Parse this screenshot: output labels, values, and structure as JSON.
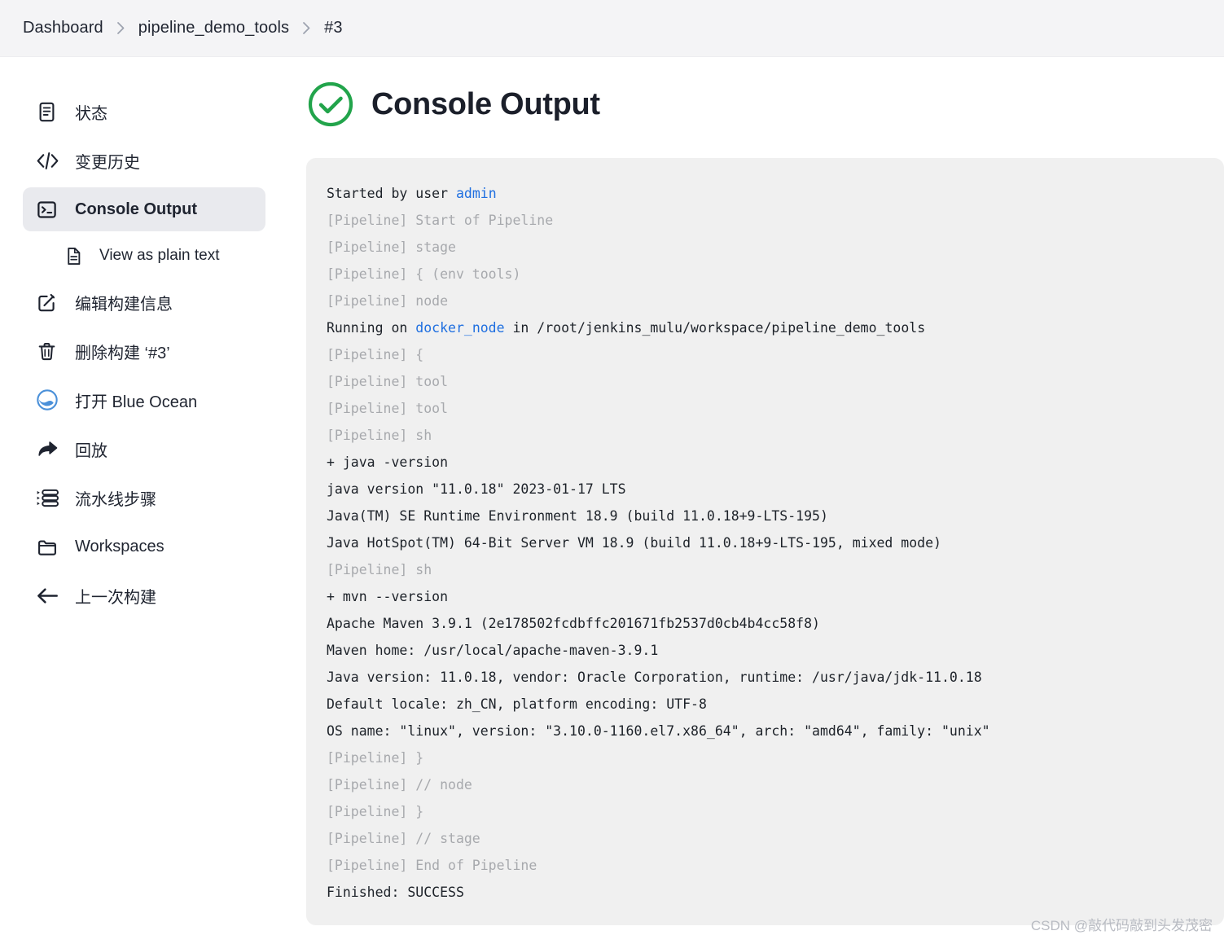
{
  "breadcrumb": {
    "items": [
      {
        "label": "Dashboard",
        "name": "breadcrumb-dashboard"
      },
      {
        "label": "pipeline_demo_tools",
        "name": "breadcrumb-job"
      },
      {
        "label": "#3",
        "name": "breadcrumb-build"
      }
    ],
    "separator": "›"
  },
  "sidebar": {
    "items": [
      {
        "label": "状态",
        "icon": "document-icon",
        "name": "sidebar-item-status",
        "active": false,
        "sub": false
      },
      {
        "label": "变更历史",
        "icon": "code-icon",
        "name": "sidebar-item-changes",
        "active": false,
        "sub": false
      },
      {
        "label": "Console Output",
        "icon": "terminal-icon",
        "name": "sidebar-item-console-output",
        "active": true,
        "sub": false
      },
      {
        "label": "View as plain text",
        "icon": "plain-text-icon",
        "name": "sidebar-item-view-as-plain-text",
        "active": false,
        "sub": true
      },
      {
        "label": "编辑构建信息",
        "icon": "edit-icon",
        "name": "sidebar-item-edit-build-information",
        "active": false,
        "sub": false
      },
      {
        "label": "删除构建 ‘#3’",
        "icon": "trash-icon",
        "name": "sidebar-item-delete-build",
        "active": false,
        "sub": false
      },
      {
        "label": "打开 Blue Ocean",
        "icon": "blue-ocean-icon",
        "name": "sidebar-item-open-blue-ocean",
        "active": false,
        "sub": false
      },
      {
        "label": "回放",
        "icon": "replay-icon",
        "name": "sidebar-item-replay",
        "active": false,
        "sub": false
      },
      {
        "label": "流水线步骤",
        "icon": "pipeline-steps-icon",
        "name": "sidebar-item-pipeline-steps",
        "active": false,
        "sub": false
      },
      {
        "label": "Workspaces",
        "icon": "folder-icon",
        "name": "sidebar-item-workspaces",
        "active": false,
        "sub": false
      },
      {
        "label": "上一次构建",
        "icon": "arrow-left-icon",
        "name": "sidebar-item-previous-build",
        "active": false,
        "sub": false
      }
    ]
  },
  "main": {
    "title": "Console Output",
    "status_icon": "success-check-icon",
    "status_color": "#22a44b",
    "link_color": "#1f6fe0",
    "console_lines": [
      {
        "style": "normal",
        "segments": [
          {
            "t": "Started by user "
          },
          {
            "t": "admin",
            "link": true
          }
        ]
      },
      {
        "style": "dim",
        "segments": [
          {
            "t": "[Pipeline] Start of Pipeline"
          }
        ]
      },
      {
        "style": "dim",
        "segments": [
          {
            "t": "[Pipeline] stage"
          }
        ]
      },
      {
        "style": "dim",
        "segments": [
          {
            "t": "[Pipeline] { (env tools)"
          }
        ]
      },
      {
        "style": "dim",
        "segments": [
          {
            "t": "[Pipeline] node"
          }
        ]
      },
      {
        "style": "normal",
        "segments": [
          {
            "t": "Running on "
          },
          {
            "t": "docker_node",
            "link": true
          },
          {
            "t": " in /root/jenkins_mulu/workspace/pipeline_demo_tools"
          }
        ]
      },
      {
        "style": "dim",
        "segments": [
          {
            "t": "[Pipeline] {"
          }
        ]
      },
      {
        "style": "dim",
        "segments": [
          {
            "t": "[Pipeline] tool"
          }
        ]
      },
      {
        "style": "dim",
        "segments": [
          {
            "t": "[Pipeline] tool"
          }
        ]
      },
      {
        "style": "dim",
        "segments": [
          {
            "t": "[Pipeline] sh"
          }
        ]
      },
      {
        "style": "normal",
        "segments": [
          {
            "t": "+ java -version"
          }
        ]
      },
      {
        "style": "normal",
        "segments": [
          {
            "t": "java version \"11.0.18\" 2023-01-17 LTS"
          }
        ]
      },
      {
        "style": "normal",
        "segments": [
          {
            "t": "Java(TM) SE Runtime Environment 18.9 (build 11.0.18+9-LTS-195)"
          }
        ]
      },
      {
        "style": "normal",
        "segments": [
          {
            "t": "Java HotSpot(TM) 64-Bit Server VM 18.9 (build 11.0.18+9-LTS-195, mixed mode)"
          }
        ]
      },
      {
        "style": "dim",
        "segments": [
          {
            "t": "[Pipeline] sh"
          }
        ]
      },
      {
        "style": "normal",
        "segments": [
          {
            "t": "+ mvn --version"
          }
        ]
      },
      {
        "style": "normal",
        "segments": [
          {
            "t": "Apache Maven 3.9.1 (2e178502fcdbffc201671fb2537d0cb4b4cc58f8)"
          }
        ]
      },
      {
        "style": "normal",
        "segments": [
          {
            "t": "Maven home: /usr/local/apache-maven-3.9.1"
          }
        ]
      },
      {
        "style": "normal",
        "segments": [
          {
            "t": "Java version: 11.0.18, vendor: Oracle Corporation, runtime: /usr/java/jdk-11.0.18"
          }
        ]
      },
      {
        "style": "normal",
        "segments": [
          {
            "t": "Default locale: zh_CN, platform encoding: UTF-8"
          }
        ]
      },
      {
        "style": "normal",
        "segments": [
          {
            "t": "OS name: \"linux\", version: \"3.10.0-1160.el7.x86_64\", arch: \"amd64\", family: \"unix\""
          }
        ]
      },
      {
        "style": "dim",
        "segments": [
          {
            "t": "[Pipeline] }"
          }
        ]
      },
      {
        "style": "dim",
        "segments": [
          {
            "t": "[Pipeline] // node"
          }
        ]
      },
      {
        "style": "dim",
        "segments": [
          {
            "t": "[Pipeline] }"
          }
        ]
      },
      {
        "style": "dim",
        "segments": [
          {
            "t": "[Pipeline] // stage"
          }
        ]
      },
      {
        "style": "dim",
        "segments": [
          {
            "t": "[Pipeline] End of Pipeline"
          }
        ]
      },
      {
        "style": "normal",
        "segments": [
          {
            "t": "Finished: SUCCESS"
          }
        ]
      }
    ]
  },
  "watermark": {
    "text": "CSDN @敲代码敲到头发茂密"
  }
}
